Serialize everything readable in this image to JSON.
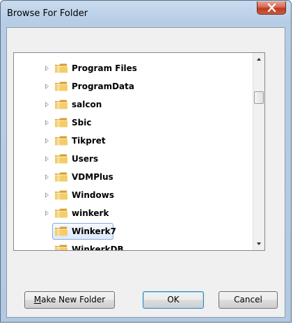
{
  "window": {
    "title": "Browse For Folder"
  },
  "tree": {
    "items": [
      {
        "label": "Program Files",
        "expandable": true,
        "selected": false
      },
      {
        "label": "ProgramData",
        "expandable": true,
        "selected": false
      },
      {
        "label": "salcon",
        "expandable": true,
        "selected": false
      },
      {
        "label": "Sbic",
        "expandable": true,
        "selected": false
      },
      {
        "label": "Tikpret",
        "expandable": true,
        "selected": false
      },
      {
        "label": "Users",
        "expandable": true,
        "selected": false
      },
      {
        "label": "VDMPlus",
        "expandable": true,
        "selected": false
      },
      {
        "label": "Windows",
        "expandable": true,
        "selected": false
      },
      {
        "label": "winkerk",
        "expandable": true,
        "selected": false
      },
      {
        "label": "Winkerk7",
        "expandable": false,
        "selected": true
      },
      {
        "label": "WinkerkDB",
        "expandable": false,
        "selected": false
      }
    ]
  },
  "buttons": {
    "make_new_folder_first": "M",
    "make_new_folder_rest": "ake New Folder",
    "ok": "OK",
    "cancel": "Cancel"
  },
  "colors": {
    "title_bar": "#c9dbee",
    "close_button": "#c0391f",
    "selection_border": "#84acdd",
    "folder": "#e8b84a"
  },
  "icons": {
    "close": "close-icon",
    "folder": "folder-icon",
    "expander": "chevron-right-icon"
  }
}
